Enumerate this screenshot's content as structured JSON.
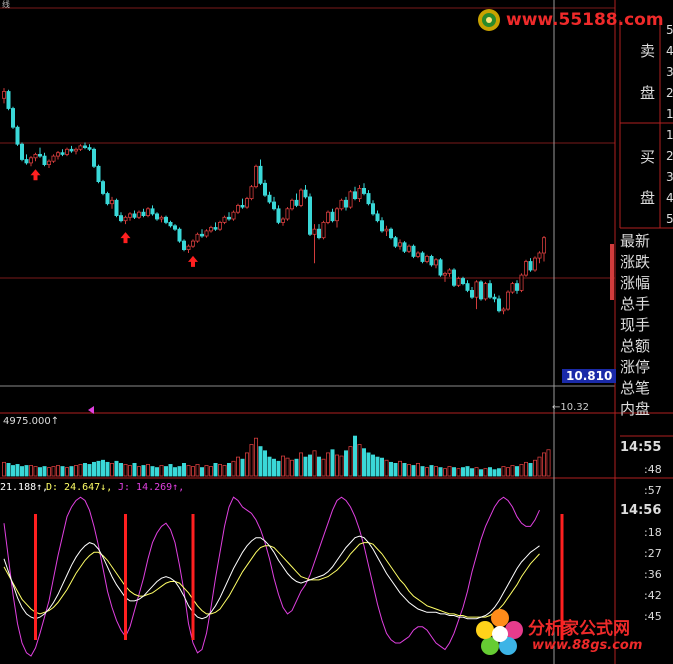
{
  "header": {
    "code": "线"
  },
  "watermark_top": {
    "url": "www.55188.com"
  },
  "watermark_bottom": {
    "brand": "分析家公式网",
    "url": "www.88gs.com"
  },
  "order_book": {
    "sell_label_1": "卖",
    "sell_label_2": "盘",
    "buy_label_1": "买",
    "buy_label_2": "盘",
    "sell_levels": [
      "5",
      "4",
      "3",
      "2",
      "1"
    ],
    "buy_levels": [
      "1",
      "2",
      "3",
      "4",
      "5"
    ]
  },
  "quote_fields": [
    "最新",
    "涨跌",
    "涨幅",
    "总手",
    "现手",
    "总额",
    "涨停",
    "总笔",
    "内盘"
  ],
  "price_tag": "10.810",
  "low_marker": "←10.32",
  "volume_label": "4975.000↑",
  "kdj_legend": {
    "k": "21.188↑,",
    "d": "D: 24.647↓,",
    "j": "J: 14.269↑,"
  },
  "ticks": [
    {
      "time": "14:55",
      "price": ":48"
    },
    {
      "time": "",
      "price": ":57"
    },
    {
      "time": "14:56",
      "price": ":18"
    },
    {
      "time": "",
      "price": ":27"
    },
    {
      "time": "",
      "price": ":36"
    },
    {
      "time": "",
      "price": ":42"
    },
    {
      "time": "",
      "price": ":45"
    }
  ],
  "colors": {
    "up": "#d23c3c",
    "down": "#3ad8d8",
    "k_line": "#ffffff",
    "d_line": "#ffff66",
    "j_line": "#e040e0",
    "signal": "#ff2020",
    "grid": "#7a1a1a",
    "price_tag_bg": "#1a2aa8"
  },
  "chart_data": {
    "type": "candlestick",
    "candles": [
      [
        91,
        97,
        88,
        95
      ],
      [
        95,
        96,
        84,
        85
      ],
      [
        85,
        86,
        73,
        74
      ],
      [
        74,
        75,
        63,
        64
      ],
      [
        64,
        65,
        54,
        55
      ],
      [
        55,
        58,
        52,
        53
      ],
      [
        53,
        57,
        51,
        56
      ],
      [
        56,
        59,
        54,
        58
      ],
      [
        58,
        62,
        56,
        57
      ],
      [
        57,
        59,
        51,
        52
      ],
      [
        52,
        55,
        50,
        54
      ],
      [
        54,
        58,
        53,
        57
      ],
      [
        57,
        60,
        55,
        59
      ],
      [
        59,
        61,
        57,
        58
      ],
      [
        58,
        62,
        57,
        61
      ],
      [
        61,
        63,
        59,
        60
      ],
      [
        60,
        62,
        58,
        61
      ],
      [
        61,
        64,
        60,
        63
      ],
      [
        63,
        65,
        61,
        62
      ],
      [
        62,
        64,
        60,
        61
      ],
      [
        61,
        62,
        50,
        51
      ],
      [
        51,
        52,
        41,
        42
      ],
      [
        42,
        43,
        34,
        35
      ],
      [
        35,
        36,
        28,
        29
      ],
      [
        29,
        33,
        26,
        31
      ],
      [
        31,
        32,
        21,
        22
      ],
      [
        22,
        24,
        18,
        19
      ],
      [
        19,
        22,
        17,
        21
      ],
      [
        21,
        24,
        19,
        23
      ],
      [
        23,
        25,
        20,
        21
      ],
      [
        21,
        25,
        20,
        24
      ],
      [
        24,
        26,
        21,
        22
      ],
      [
        22,
        27,
        21,
        26
      ],
      [
        26,
        28,
        22,
        23
      ],
      [
        23,
        24,
        19,
        20
      ],
      [
        20,
        22,
        18,
        21
      ],
      [
        21,
        22,
        17,
        18
      ],
      [
        18,
        19,
        15,
        16
      ],
      [
        16,
        17,
        13,
        14
      ],
      [
        14,
        15,
        6,
        7
      ],
      [
        7,
        8,
        1,
        2
      ],
      [
        2,
        5,
        0,
        4
      ],
      [
        4,
        8,
        3,
        7
      ],
      [
        7,
        12,
        6,
        11
      ],
      [
        11,
        14,
        9,
        10
      ],
      [
        10,
        14,
        9,
        13
      ],
      [
        13,
        16,
        12,
        15
      ],
      [
        15,
        18,
        13,
        14
      ],
      [
        14,
        19,
        13,
        18
      ],
      [
        18,
        22,
        17,
        21
      ],
      [
        21,
        24,
        19,
        20
      ],
      [
        20,
        25,
        19,
        24
      ],
      [
        24,
        29,
        23,
        28
      ],
      [
        28,
        32,
        26,
        27
      ],
      [
        27,
        33,
        26,
        32
      ],
      [
        32,
        40,
        31,
        39
      ],
      [
        39,
        52,
        38,
        51
      ],
      [
        51,
        55,
        40,
        41
      ],
      [
        41,
        43,
        33,
        34
      ],
      [
        34,
        36,
        29,
        30
      ],
      [
        30,
        33,
        25,
        26
      ],
      [
        26,
        28,
        17,
        18
      ],
      [
        18,
        21,
        16,
        20
      ],
      [
        20,
        27,
        19,
        26
      ],
      [
        26,
        32,
        25,
        31
      ],
      [
        31,
        35,
        27,
        28
      ],
      [
        28,
        38,
        27,
        37
      ],
      [
        37,
        40,
        32,
        33
      ],
      [
        33,
        35,
        10,
        11
      ],
      [
        11,
        17,
        -6,
        14
      ],
      [
        14,
        17,
        8,
        9
      ],
      [
        9,
        19,
        8,
        18
      ],
      [
        18,
        25,
        17,
        24
      ],
      [
        24,
        26,
        18,
        19
      ],
      [
        19,
        27,
        15,
        26
      ],
      [
        26,
        32,
        25,
        31
      ],
      [
        31,
        33,
        25,
        27
      ],
      [
        27,
        37,
        26,
        36
      ],
      [
        36,
        39,
        31,
        32
      ],
      [
        32,
        40,
        30,
        38
      ],
      [
        38,
        41,
        34,
        35
      ],
      [
        35,
        37,
        28,
        29
      ],
      [
        29,
        31,
        22,
        23
      ],
      [
        23,
        25,
        18,
        19
      ],
      [
        19,
        21,
        12,
        13
      ],
      [
        13,
        16,
        10,
        14
      ],
      [
        14,
        15,
        8,
        9
      ],
      [
        9,
        10,
        3,
        4
      ],
      [
        4,
        8,
        2,
        6
      ],
      [
        6,
        7,
        0,
        1
      ],
      [
        1,
        5,
        0,
        4
      ],
      [
        4,
        5,
        -3,
        -2
      ],
      [
        -2,
        1,
        -3,
        0
      ],
      [
        0,
        1,
        -6,
        -5
      ],
      [
        -5,
        -1,
        -6,
        -2
      ],
      [
        -2,
        -1,
        -8,
        -7
      ],
      [
        -7,
        -3,
        -9,
        -4
      ],
      [
        -4,
        -3,
        -14,
        -13
      ],
      [
        -13,
        -11,
        -17,
        -12
      ],
      [
        -12,
        -9,
        -14,
        -10
      ],
      [
        -10,
        -9,
        -20,
        -19
      ],
      [
        -19,
        -14,
        -20,
        -15
      ],
      [
        -15,
        -14,
        -19,
        -18
      ],
      [
        -18,
        -16,
        -23,
        -22
      ],
      [
        -22,
        -20,
        -27,
        -26
      ],
      [
        -26,
        -16,
        -33,
        -17
      ],
      [
        -17,
        -16,
        -28,
        -27
      ],
      [
        -27,
        -17,
        -28,
        -18
      ],
      [
        -18,
        -16,
        -27,
        -26
      ],
      [
        -26,
        -24,
        -29,
        -27
      ],
      [
        -27,
        -25,
        -35,
        -34
      ],
      [
        -34,
        -32,
        -36,
        -33
      ],
      [
        -33,
        -22,
        -34,
        -23
      ],
      [
        -23,
        -17,
        -24,
        -18
      ],
      [
        -18,
        -16,
        -24,
        -22
      ],
      [
        -22,
        -12,
        -23,
        -13
      ],
      [
        -13,
        -4,
        -14,
        -5
      ],
      [
        -5,
        -3,
        -11,
        -10
      ],
      [
        -10,
        -2,
        -11,
        -3
      ],
      [
        -3,
        1,
        -6,
        0
      ],
      [
        0,
        10,
        -5,
        9
      ]
    ],
    "volume": [
      13,
      12,
      10,
      11,
      9,
      10,
      10,
      9,
      8,
      9,
      8,
      9,
      10,
      9,
      8,
      9,
      10,
      11,
      12,
      11,
      13,
      14,
      15,
      13,
      12,
      14,
      12,
      11,
      10,
      12,
      9,
      10,
      11,
      9,
      8,
      10,
      9,
      11,
      8,
      9,
      12,
      10,
      9,
      11,
      8,
      10,
      9,
      12,
      11,
      10,
      12,
      14,
      18,
      16,
      22,
      30,
      36,
      28,
      24,
      18,
      16,
      14,
      19,
      17,
      15,
      16,
      22,
      18,
      20,
      24,
      18,
      16,
      22,
      25,
      20,
      19,
      24,
      28,
      38,
      30,
      26,
      22,
      20,
      18,
      17,
      15,
      13,
      12,
      14,
      12,
      11,
      10,
      12,
      9,
      8,
      10,
      9,
      8,
      7,
      9,
      8,
      7,
      8,
      9,
      7,
      8,
      6,
      7,
      8,
      6,
      7,
      9,
      8,
      10,
      9,
      11,
      13,
      12,
      15,
      18,
      22,
      25
    ],
    "kdj": {
      "k": [
        60,
        52,
        44,
        36,
        30,
        26,
        24,
        23,
        24,
        26,
        29,
        33,
        38,
        44,
        50,
        56,
        61,
        65,
        68,
        70,
        69,
        66,
        61,
        55,
        49,
        44,
        40,
        36,
        34,
        34,
        35,
        37,
        40,
        43,
        46,
        48,
        49,
        48,
        46,
        42,
        37,
        31,
        27,
        24,
        23,
        24,
        27,
        31,
        36,
        42,
        48,
        54,
        59,
        64,
        68,
        71,
        73,
        73,
        71,
        68,
        64,
        59,
        55,
        51,
        48,
        46,
        45,
        46,
        47,
        48,
        49,
        50,
        52,
        55,
        59,
        63,
        67,
        70,
        73,
        74,
        73,
        70,
        66,
        61,
        56,
        51,
        47,
        43,
        39,
        36,
        33,
        31,
        29,
        28,
        27,
        27,
        27,
        26,
        26,
        25,
        25,
        24,
        24,
        23,
        23,
        23,
        24,
        25,
        27,
        30,
        34,
        39,
        44,
        49,
        54,
        58,
        61,
        64,
        66,
        68
      ],
      "d": [
        55,
        50,
        45,
        40,
        35,
        32,
        29,
        27,
        26,
        27,
        28,
        30,
        33,
        37,
        41,
        46,
        51,
        55,
        59,
        62,
        64,
        64,
        62,
        59,
        55,
        51,
        47,
        43,
        40,
        38,
        37,
        37,
        38,
        39,
        41,
        43,
        45,
        46,
        46,
        45,
        42,
        39,
        35,
        31,
        28,
        26,
        26,
        27,
        29,
        33,
        37,
        42,
        47,
        52,
        56,
        60,
        64,
        67,
        68,
        68,
        67,
        64,
        61,
        58,
        55,
        52,
        49,
        48,
        47,
        47,
        47,
        48,
        49,
        51,
        53,
        56,
        59,
        63,
        66,
        69,
        70,
        70,
        69,
        66,
        63,
        59,
        55,
        51,
        47,
        44,
        40,
        37,
        35,
        33,
        31,
        30,
        29,
        28,
        27,
        26,
        26,
        25,
        25,
        24,
        24,
        24,
        24,
        24,
        25,
        27,
        29,
        32,
        36,
        40,
        44,
        49,
        53,
        57,
        60,
        63
      ],
      "j": [
        82,
        60,
        38,
        20,
        8,
        2,
        0,
        5,
        14,
        24,
        34,
        48,
        62,
        74,
        86,
        92,
        96,
        98,
        96,
        90,
        80,
        68,
        54,
        40,
        30,
        22,
        16,
        12,
        18,
        28,
        38,
        48,
        60,
        70,
        76,
        80,
        82,
        78,
        70,
        56,
        40,
        20,
        8,
        2,
        4,
        14,
        30,
        48,
        64,
        80,
        92,
        98,
        96,
        92,
        90,
        88,
        84,
        78,
        70,
        60,
        48,
        38,
        30,
        26,
        28,
        34,
        40,
        44,
        50,
        58,
        66,
        74,
        82,
        90,
        96,
        98,
        96,
        92,
        86,
        78,
        68,
        56,
        44,
        32,
        22,
        14,
        10,
        8,
        8,
        10,
        12,
        16,
        18,
        18,
        16,
        12,
        8,
        6,
        4,
        8,
        14,
        22,
        30,
        40,
        52,
        62,
        72,
        80,
        86,
        92,
        96,
        98,
        96,
        92,
        86,
        82,
        80,
        80,
        84,
        90
      ]
    },
    "buy_signals": [
      7,
      27,
      42,
      124
    ],
    "kdj_signals": [
      7,
      27,
      42,
      124
    ]
  }
}
